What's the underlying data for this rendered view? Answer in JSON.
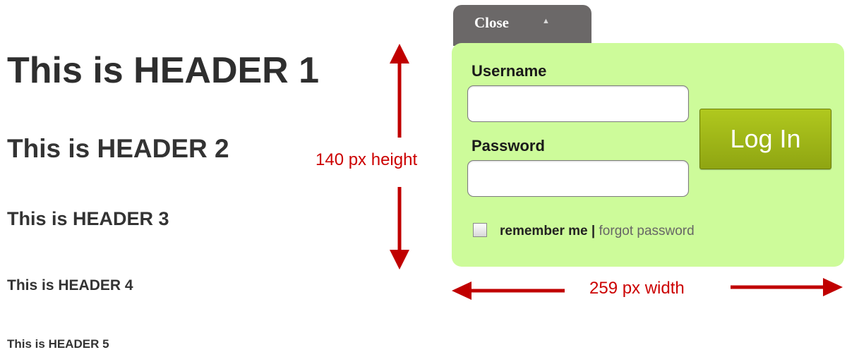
{
  "headers": {
    "h1": "This is HEADER 1",
    "h2": "This is HEADER 2",
    "h3": "This is HEADER 3",
    "h4": "This is HEADER 4",
    "h5": "This is HEADER 5"
  },
  "annotations": {
    "height_label": "140 px height",
    "width_label": "259 px width",
    "arrow_color": "#cc0000"
  },
  "login": {
    "close_label": "Close",
    "close_icon": "caret-up-icon",
    "username_label": "Username",
    "username_value": "",
    "password_label": "Password",
    "password_value": "",
    "login_button_label": "Log In",
    "remember_label": "remember me",
    "separator": "|",
    "forgot_link": "forgot password",
    "panel_color": "#cdfb9a",
    "button_color": "#9cb417",
    "tab_color": "#6b6868"
  }
}
